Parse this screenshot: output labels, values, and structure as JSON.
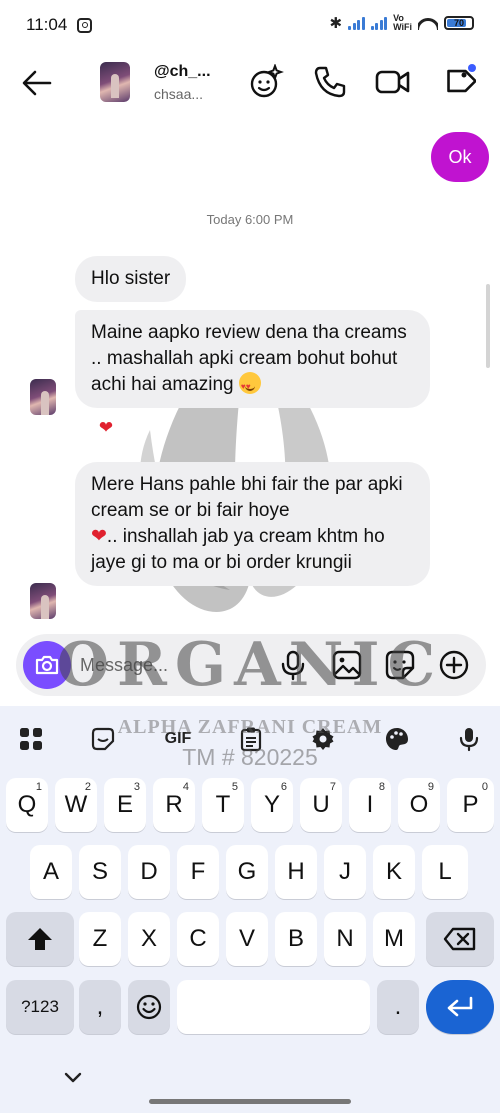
{
  "status_bar": {
    "time": "11:04",
    "vo_label": "Vo",
    "wifi_label": "WiFi",
    "battery": "70"
  },
  "header": {
    "name": "@ch_...",
    "username": "chsaa..."
  },
  "chat": {
    "outgoing": [
      {
        "text": "Ok"
      }
    ],
    "timestamp": "Today 6:00 PM",
    "messages": [
      {
        "text": "Hlo sister"
      },
      {
        "text": "Maine aapko review dena tha creams .. mashallah apki cream bohut bohut achi hai amazing"
      },
      {
        "text": "Mere Hans pahle bhi fair the  par apki cream se or bi  fair hoye",
        "text2": ".. inshallah jab ya cream khtm ho jaye gi to ma or bi order krungii"
      }
    ],
    "reaction": "❤"
  },
  "composer": {
    "placeholder": "Message..."
  },
  "watermark": {
    "brand": "ORGANIC",
    "product": "ALPHA ZAFRANI CREAM",
    "trademark": "TM # 820225"
  },
  "keyboard": {
    "toolbar": {
      "gif_label": "GIF"
    },
    "row1": [
      {
        "key": "Q",
        "hint": "1"
      },
      {
        "key": "W",
        "hint": "2"
      },
      {
        "key": "E",
        "hint": "3"
      },
      {
        "key": "R",
        "hint": "4"
      },
      {
        "key": "T",
        "hint": "5"
      },
      {
        "key": "Y",
        "hint": "6"
      },
      {
        "key": "U",
        "hint": "7"
      },
      {
        "key": "I",
        "hint": "8"
      },
      {
        "key": "O",
        "hint": "9"
      },
      {
        "key": "P",
        "hint": "0"
      }
    ],
    "row2": [
      "A",
      "S",
      "D",
      "F",
      "G",
      "H",
      "J",
      "K",
      "L"
    ],
    "row3": [
      "Z",
      "X",
      "C",
      "V",
      "B",
      "N",
      "M"
    ],
    "row4": {
      "symbols": "?123",
      "comma": ",",
      "period": "."
    }
  },
  "icons": {
    "back": "arrow-left-icon",
    "effects": "sparkle-smile-icon",
    "call": "phone-icon",
    "video": "video-camera-icon",
    "tag": "tag-icon",
    "camera": "camera-icon",
    "mic": "microphone-icon",
    "gallery": "image-icon",
    "sticker": "sticker-icon",
    "add": "plus-circle-icon"
  },
  "colors": {
    "outgoing_bubble": "#c013d0",
    "incoming_bubble": "#efeff1",
    "camera_button": "#7a4dff",
    "enter_key": "#1a64d3",
    "keyboard_bg": "#eef1fa"
  }
}
